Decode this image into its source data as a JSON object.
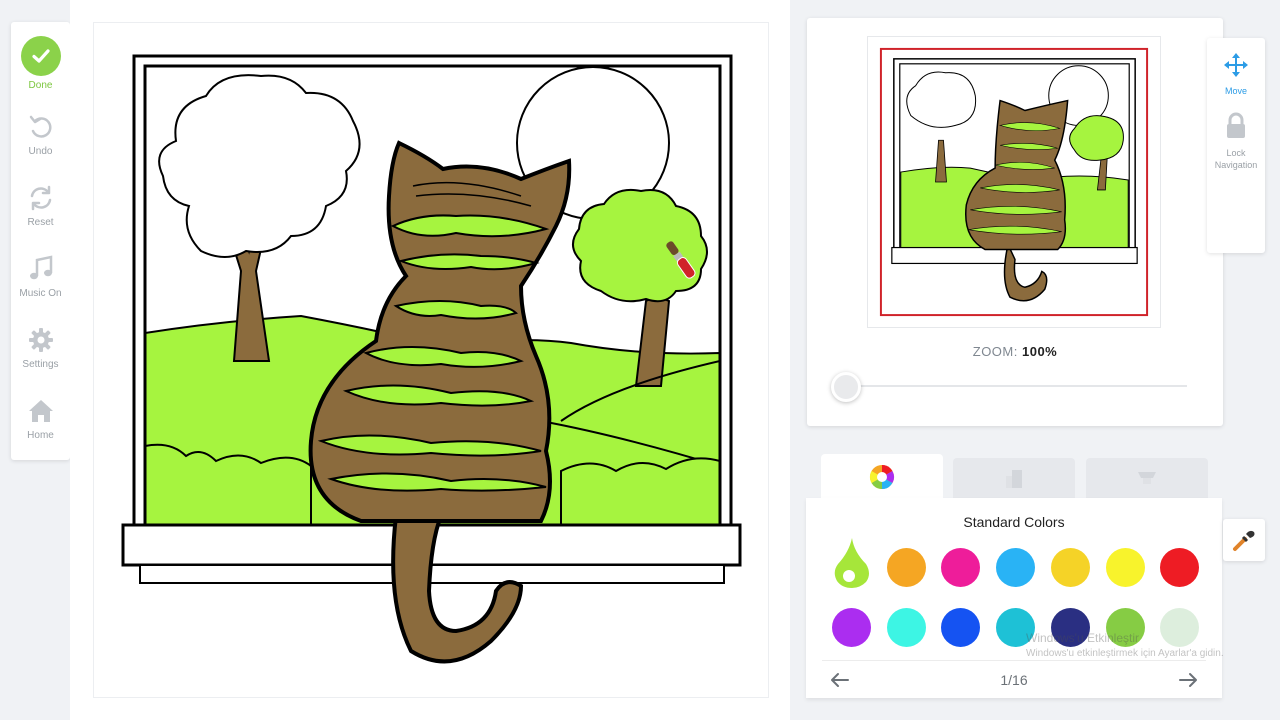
{
  "toolbar": {
    "done": "Done",
    "undo": "Undo",
    "reset": "Reset",
    "music": "Music On",
    "settings": "Settings",
    "home": "Home"
  },
  "navigator": {
    "zoom_label": "ZOOM:",
    "zoom_value": "100%",
    "zoom_level": 1.0
  },
  "right_tools": {
    "move": "Move",
    "lock_line1": "Lock",
    "lock_line2": "Navigation"
  },
  "palette": {
    "title": "Standard Colors",
    "page": "1/16",
    "selected_color": "#a6e63a",
    "colors_row1": [
      "#a6e63a",
      "#f5a623",
      "#ee1d9a",
      "#29b3f5",
      "#f5d327",
      "#f8f32c",
      "#ee1c24"
    ],
    "colors_row2": [
      "#ab2df0",
      "#3df5e4",
      "#1553f2",
      "#1ec1d6",
      "#2a2f82",
      "#86cc44",
      "#ddeedd"
    ]
  },
  "colors": {
    "cat_brown": "#8b6b3d",
    "grass_green": "#a6f43f",
    "done_green": "#8bd24a",
    "accent_blue": "#2c9ce6",
    "view_box_red": "#d0222a"
  },
  "icons": {
    "done": "check-icon",
    "undo": "undo-icon",
    "reset": "reset-icon",
    "music": "music-note-icon",
    "settings": "gear-icon",
    "home": "home-icon",
    "move": "move-arrows-icon",
    "lock": "lock-icon",
    "eyedropper": "eyedropper-icon"
  },
  "watermark": {
    "line1": "Windows'u Etkinleştir",
    "line2": "Windows'u etkinleştirmek için Ayarlar'a gidin."
  }
}
